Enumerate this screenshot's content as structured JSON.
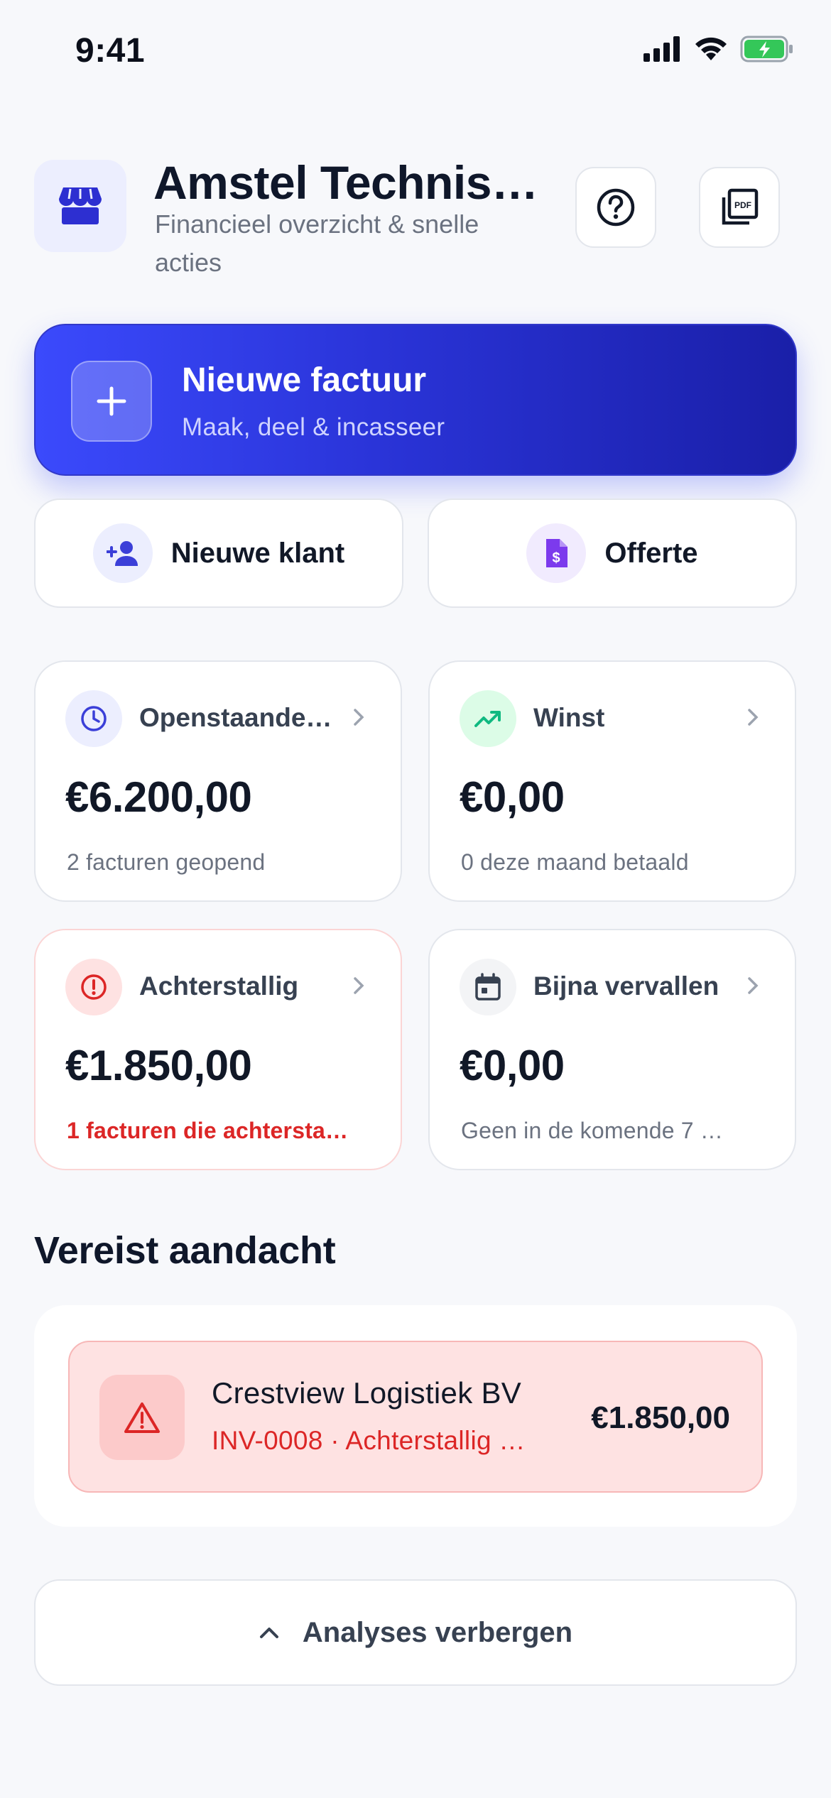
{
  "status_bar": {
    "time": "9:41"
  },
  "header": {
    "title": "Amstel Technis…",
    "subtitle": "Financieel overzicht & snelle acties",
    "pdf_icon_text": "PDF"
  },
  "hero": {
    "title": "Nieuwe factuur",
    "subtitle": "Maak, deel & incasseer",
    "accent_start": "#3b4afc",
    "accent_end": "#1a1fa8"
  },
  "quick_actions": [
    {
      "label": "Nieuwe klant",
      "icon": "person-add-icon"
    },
    {
      "label": "Offerte",
      "icon": "invoice-dollar-icon"
    }
  ],
  "stats": [
    {
      "label": "Openstaande…",
      "value": "€6.200,00",
      "footer": "2 facturen geopend",
      "icon": "clock-icon",
      "icon_color": "#3b3fd8",
      "icon_bg": "#eceefe"
    },
    {
      "label": "Winst",
      "value": "€0,00",
      "footer": "0 deze maand betaald",
      "icon": "trending-up-icon",
      "icon_color": "#10b981",
      "icon_bg": "#dcfce7"
    },
    {
      "label": "Achterstallig",
      "value": "€1.850,00",
      "footer": "1 facturen die achtersta…",
      "icon": "alert-circle-icon",
      "icon_color": "#dc2626",
      "icon_bg": "#fee2e2"
    },
    {
      "label": "Bijna vervallen",
      "value": "€0,00",
      "footer": "Geen in de komende 7 …",
      "icon": "calendar-icon",
      "icon_color": "#374151",
      "icon_bg": "#f3f4f6"
    }
  ],
  "attention": {
    "title": "Vereist aandacht",
    "items": [
      {
        "name": "Crestview Logistiek BV",
        "meta": "INV-0008 · Achterstallig …",
        "amount": "€1.850,00",
        "icon": "warning-triangle-icon"
      }
    ]
  },
  "analyses_toggle": {
    "label": "Analyses verbergen",
    "icon": "chevron-up-icon"
  }
}
